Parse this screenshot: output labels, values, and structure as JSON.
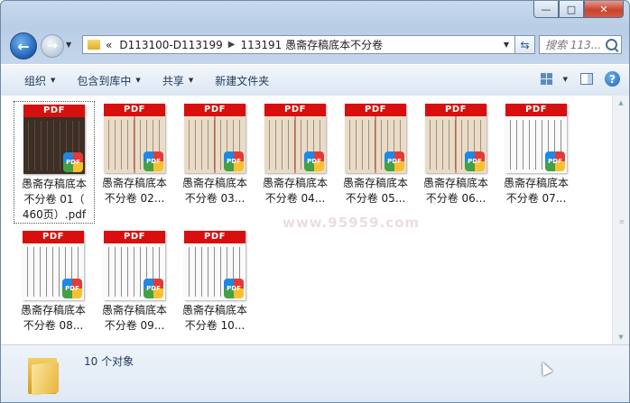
{
  "window": {
    "minimize": "—",
    "maximize": "□",
    "close": "✕"
  },
  "nav": {
    "back_arrow": "←",
    "forward_arrow": "→",
    "breadcrumb_prefix": "«",
    "path": [
      "D113100-D113199",
      "113191 愚斋存稿底本不分卷"
    ],
    "search_placeholder": "搜索 113..."
  },
  "toolbar": {
    "items": [
      "组织",
      "包含到库中",
      "共享",
      "新建文件夹"
    ],
    "help": "?"
  },
  "files": [
    {
      "line1": "愚斋存稿底本",
      "line2": "不分卷 01（",
      "line3": "460页）.pdf",
      "style": "dark",
      "selected": true
    },
    {
      "line1": "愚斋存稿底本",
      "line2": "不分卷 02...",
      "line3": "",
      "style": "aged",
      "selected": false
    },
    {
      "line1": "愚斋存稿底本",
      "line2": "不分卷 03...",
      "line3": "",
      "style": "aged",
      "selected": false
    },
    {
      "line1": "愚斋存稿底本",
      "line2": "不分卷 04...",
      "line3": "",
      "style": "aged",
      "selected": false
    },
    {
      "line1": "愚斋存稿底本",
      "line2": "不分卷 05...",
      "line3": "",
      "style": "aged",
      "selected": false
    },
    {
      "line1": "愚斋存稿底本",
      "line2": "不分卷 06...",
      "line3": "",
      "style": "aged",
      "selected": false
    },
    {
      "line1": "愚斋存稿底本",
      "line2": "不分卷 07...",
      "line3": "",
      "style": "white",
      "selected": false
    },
    {
      "line1": "愚斋存稿底本",
      "line2": "不分卷 08...",
      "line3": "",
      "style": "white",
      "selected": false
    },
    {
      "line1": "愚斋存稿底本",
      "line2": "不分卷 09...",
      "line3": "",
      "style": "white",
      "selected": false
    },
    {
      "line1": "愚斋存稿底本",
      "line2": "不分卷 10...",
      "line3": "",
      "style": "white",
      "selected": false
    }
  ],
  "thumb_header": "PDF",
  "badge_text": "PDF",
  "watermark": "www.95959.com",
  "details": {
    "count": "10 个对象"
  }
}
